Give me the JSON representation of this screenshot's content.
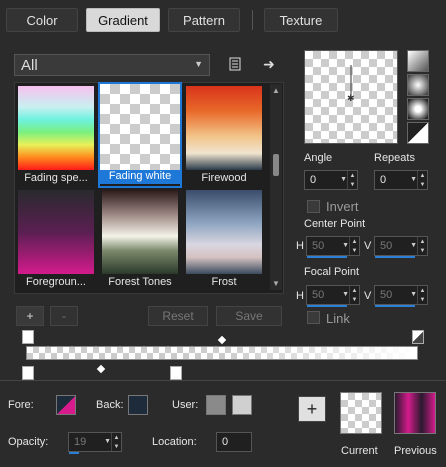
{
  "tabs": [
    {
      "label": "Color"
    },
    {
      "label": "Gradient"
    },
    {
      "label": "Pattern"
    },
    {
      "label": "Texture"
    }
  ],
  "active_tab": "Gradient",
  "filter": {
    "selected": "All"
  },
  "gallery": {
    "items": [
      {
        "label": "Fading spe..."
      },
      {
        "label": "Fading white"
      },
      {
        "label": "Firewood"
      },
      {
        "label": "Foregroun..."
      },
      {
        "label": "Forest Tones"
      },
      {
        "label": "Frost"
      }
    ],
    "selected": "Fading white"
  },
  "actions": {
    "add": "+",
    "remove": "-",
    "reset": "Reset",
    "save": "Save"
  },
  "settings": {
    "angle_label": "Angle",
    "angle_value": "0",
    "repeats_label": "Repeats",
    "repeats_value": "0",
    "invert_label": "Invert",
    "center_point_label": "Center Point",
    "center_h_label": "H",
    "center_h_value": "50",
    "center_v_label": "V",
    "center_v_value": "50",
    "focal_point_label": "Focal Point",
    "focal_h_label": "H",
    "focal_h_value": "50",
    "focal_v_label": "V",
    "focal_v_value": "50",
    "link_label": "Link"
  },
  "stops": {
    "fore_label": "Fore:",
    "back_label": "Back:",
    "user_label": "User:",
    "opacity_label": "Opacity:",
    "opacity_value": "19",
    "location_label": "Location:",
    "location_value": "0"
  },
  "previews": {
    "current_label": "Current",
    "previous_label": "Previous"
  },
  "colors": {
    "accent": "#1e78d7",
    "fore": "#d81b8c",
    "back": "#1d2b3a",
    "user1": "#8a8a8a",
    "user2": "#d0d0d0"
  }
}
